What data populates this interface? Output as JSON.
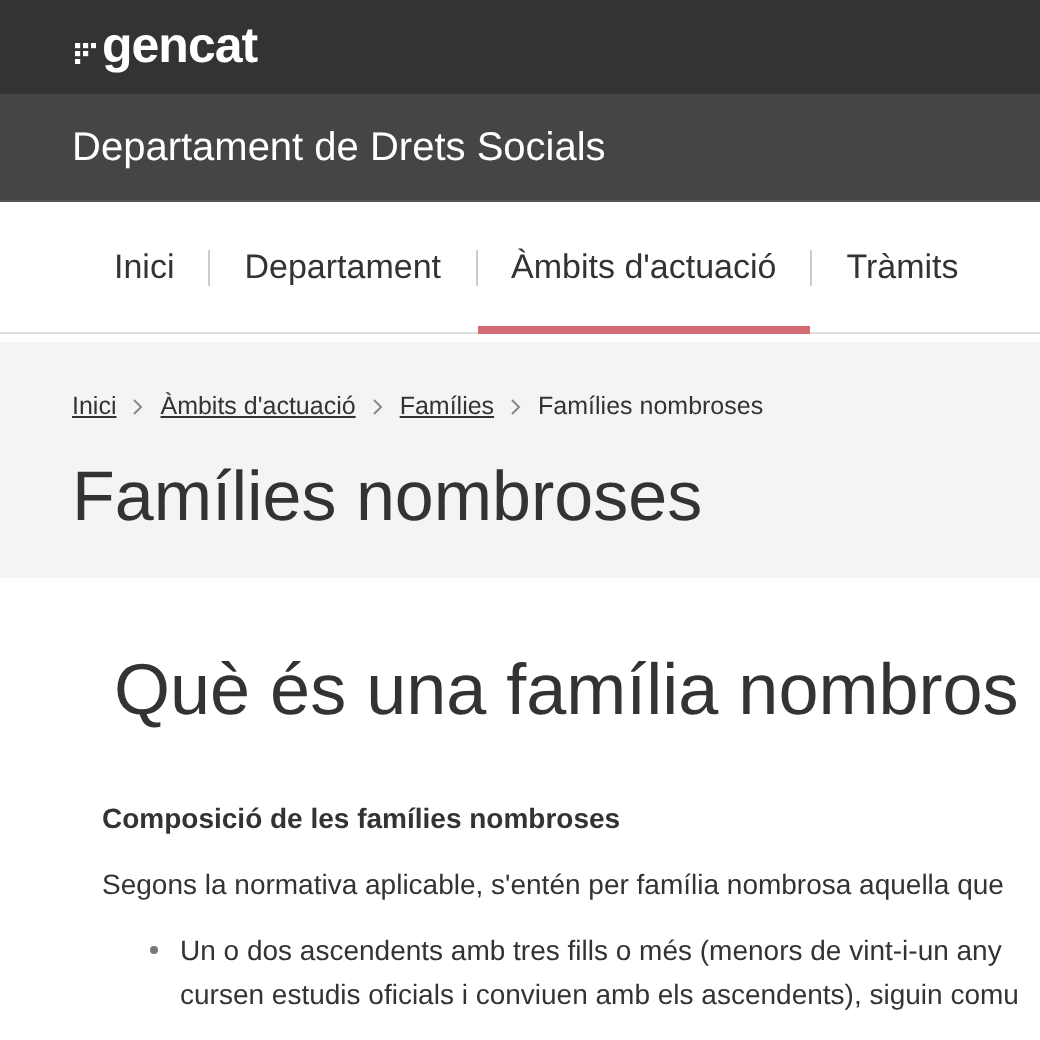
{
  "header": {
    "logo": "gencat"
  },
  "department": {
    "title": "Departament de Drets Socials"
  },
  "nav": [
    {
      "label": "Inici",
      "selected": false
    },
    {
      "label": "Departament",
      "selected": false
    },
    {
      "label": "Àmbits d'actuació",
      "selected": true
    },
    {
      "label": "Tràmits",
      "selected": false
    }
  ],
  "breadcrumb": [
    {
      "label": "Inici",
      "kind": "link"
    },
    {
      "label": "Àmbits d'actuació",
      "kind": "link"
    },
    {
      "label": "Famílies",
      "kind": "link"
    },
    {
      "label": "Famílies nombroses",
      "kind": "current"
    }
  ],
  "page_title": "Famílies nombroses",
  "section": {
    "heading": "Què és una família nombros",
    "subheading": "Composició de les famílies nombroses",
    "paragraph": "Segons la normativa aplicable, s'entén per família nombrosa aquella que",
    "bullets": [
      "Un o dos ascendents amb tres fills o més (menors de vint-i-un any\ncursen estudis oficials i conviuen amb els ascendents), siguin comu"
    ]
  }
}
